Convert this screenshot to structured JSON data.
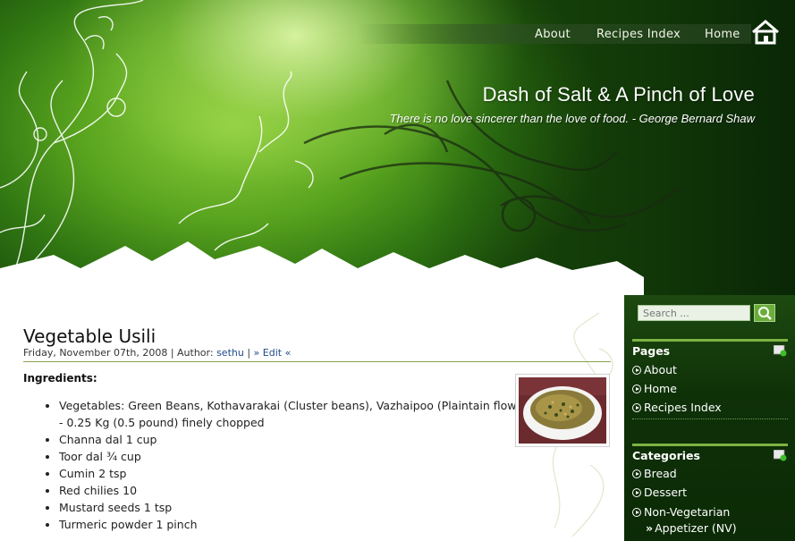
{
  "nav": {
    "about": "About",
    "recipes_index": "Recipes Index",
    "home": "Home",
    "home_icon": "house-icon"
  },
  "site": {
    "title": "Dash of Salt & A Pinch of Love",
    "tagline": "There is no love sincerer than the love of food. - George Bernard Shaw"
  },
  "post": {
    "title": "Vegetable Usili",
    "date": "Friday, November 07th, 2008",
    "author_prefix": "| Author:",
    "author": "sethu",
    "edit": "» Edit «",
    "ingredients_heading": "Ingredients:",
    "ingredients": [
      "Vegetables: Green Beans, Kothavarakai (Cluster beans), Vazhaipoo (Plaintain flower) - 0.25 Kg (0.5 pound) finely chopped",
      "Channa dal 1 cup",
      "Toor dal ¾ cup",
      "Cumin 2 tsp",
      "Red chilies 10",
      "Mustard seeds 1 tsp",
      "Turmeric powder 1 pinch"
    ]
  },
  "sidebar": {
    "search_placeholder": "Search ...",
    "pages_title": "Pages",
    "pages": [
      "About",
      "Home",
      "Recipes Index"
    ],
    "categories_title": "Categories",
    "categories": [
      "Bread",
      "Dessert",
      "Non-Vegetarian"
    ],
    "subcategory": "Appetizer (NV)"
  },
  "colors": {
    "accent_green": "#7cb342",
    "sidebar_bg": "#0f3108",
    "link_blue": "#1e4a8a"
  }
}
